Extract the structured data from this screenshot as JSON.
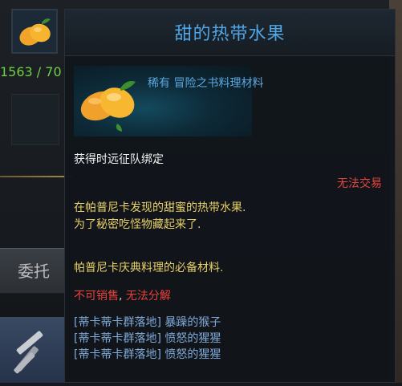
{
  "background": {
    "item_count": "1563 / 70",
    "entrust_label": "委托"
  },
  "tooltip": {
    "title": "甜的热带水果",
    "rarity_category": "稀有 冒险之书料理材料",
    "bind_info": "获得时远征队绑定",
    "trade_status": "无法交易",
    "description_lines": [
      "在帕普尼卡发现的甜蜜的热带水果.",
      "为了秘密吃怪物藏起来了."
    ],
    "usage_note": "帕普尼卡庆典料理的必备材料.",
    "restrictions": {
      "no_sell": "不可销售",
      "separator": ", ",
      "no_disassemble": "无法分解"
    },
    "drop_sources": [
      "[蒂卡蒂卡群落地] 暴躁的猴子",
      "[蒂卡蒂卡群落地] 愤怒的猩猩",
      "[蒂卡蒂卡群落地] 愤怒的猩猩"
    ]
  },
  "colors": {
    "title": "#4fa6e8",
    "rarity": "#5aa8e0",
    "warning": "#e2453b",
    "description": "#e7cf67",
    "drop_source": "#7fa9d8",
    "count": "#6fd047"
  },
  "icons": {
    "item": "mango-fruit-icon",
    "tool": "hammer-tool-icon"
  }
}
